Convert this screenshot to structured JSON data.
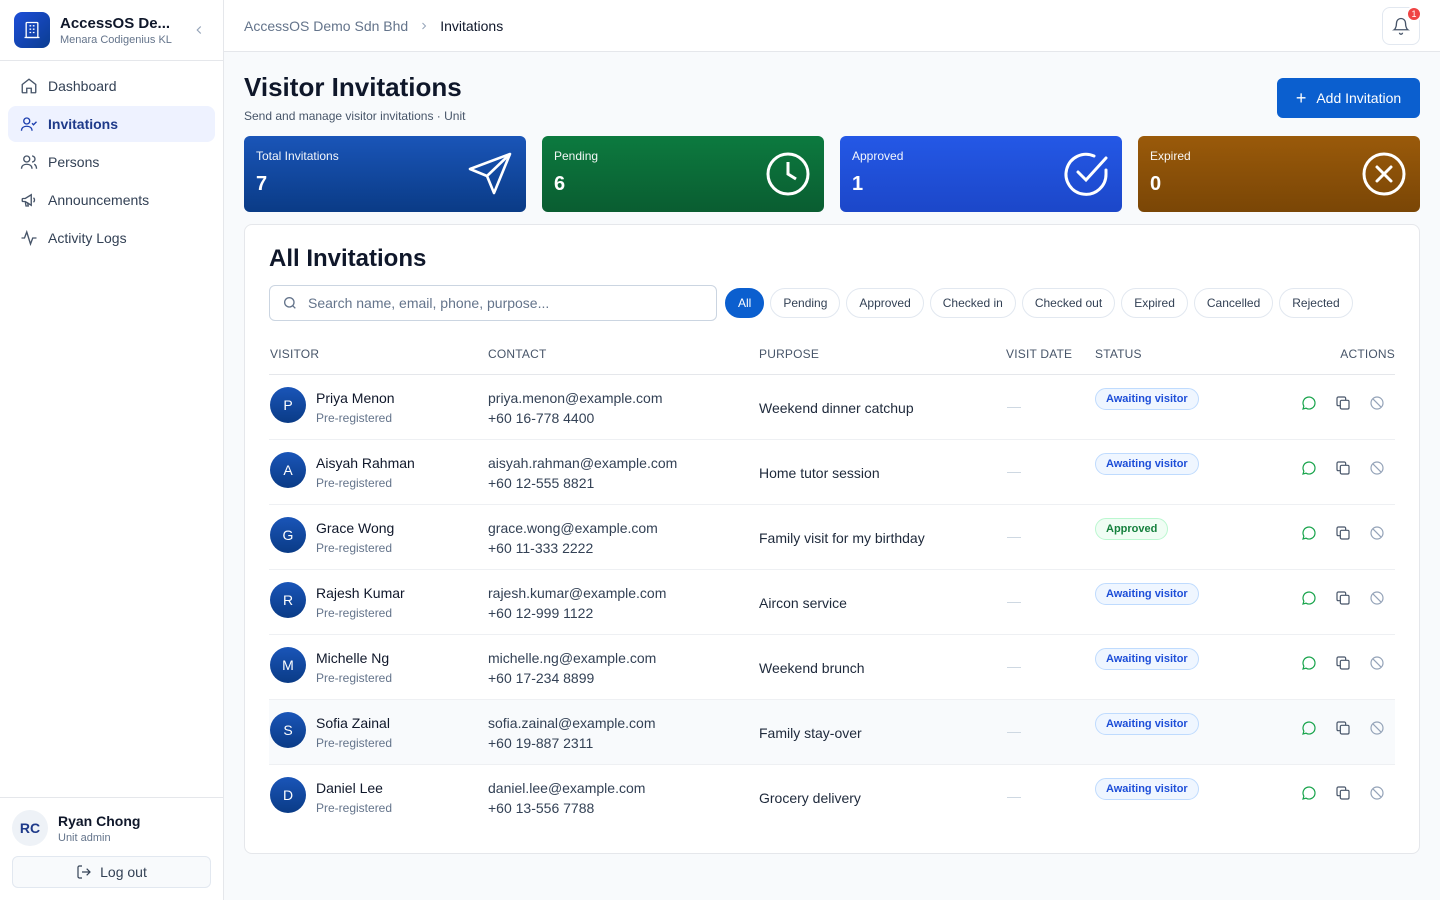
{
  "brand": {
    "name": "AccessOS De...",
    "site": "Menara Codigenius KL"
  },
  "nav": [
    {
      "label": "Dashboard",
      "icon": "home-icon"
    },
    {
      "label": "Invitations",
      "icon": "user-check-icon",
      "active": true
    },
    {
      "label": "Persons",
      "icon": "users-icon"
    },
    {
      "label": "Announcements",
      "icon": "megaphone-icon"
    },
    {
      "label": "Activity Logs",
      "icon": "activity-icon"
    }
  ],
  "user": {
    "initials": "RC",
    "name": "Ryan Chong",
    "role": "Unit admin",
    "logout_label": "Log out"
  },
  "breadcrumb": {
    "root": "AccessOS Demo Sdn Bhd",
    "current": "Invitations"
  },
  "notifications": {
    "count": "1"
  },
  "page": {
    "title": "Visitor Invitations",
    "subtitle": "Send and manage visitor invitations · Unit",
    "add_label": "Add Invitation"
  },
  "stats": [
    {
      "label": "Total Invitations",
      "value": "7",
      "icon": "send-icon",
      "color": "#0a3b86"
    },
    {
      "label": "Pending",
      "value": "6",
      "icon": "clock-icon",
      "color": "#0a5d31"
    },
    {
      "label": "Approved",
      "value": "1",
      "icon": "check-circle-icon",
      "color": "#1c47c9"
    },
    {
      "label": "Expired",
      "value": "0",
      "icon": "x-circle-icon",
      "color": "#7a4606"
    }
  ],
  "table": {
    "title": "All Invitations",
    "search_placeholder": "Search name, email, phone, purpose...",
    "filters": [
      "All",
      "Pending",
      "Approved",
      "Checked in",
      "Checked out",
      "Expired",
      "Cancelled",
      "Rejected"
    ],
    "active_filter": "All",
    "columns": {
      "visitor": "VISITOR",
      "contact": "CONTACT",
      "purpose": "PURPOSE",
      "visit_date": "VISIT DATE",
      "status": "STATUS",
      "actions": "ACTIONS"
    },
    "rows": [
      {
        "initial": "P",
        "name": "Priya Menon",
        "type": "Pre-registered",
        "email": "priya.menon@example.com",
        "phone": "+60 16-778 4400",
        "purpose": "Weekend dinner catchup",
        "visit_date": "—",
        "status": "Awaiting visitor",
        "status_kind": "await"
      },
      {
        "initial": "A",
        "name": "Aisyah Rahman",
        "type": "Pre-registered",
        "email": "aisyah.rahman@example.com",
        "phone": "+60 12-555 8821",
        "purpose": "Home tutor session",
        "visit_date": "—",
        "status": "Awaiting visitor",
        "status_kind": "await"
      },
      {
        "initial": "G",
        "name": "Grace Wong",
        "type": "Pre-registered",
        "email": "grace.wong@example.com",
        "phone": "+60 11-333 2222",
        "purpose": "Family visit for my birthday",
        "visit_date": "—",
        "status": "Approved",
        "status_kind": "appr"
      },
      {
        "initial": "R",
        "name": "Rajesh Kumar",
        "type": "Pre-registered",
        "email": "rajesh.kumar@example.com",
        "phone": "+60 12-999 1122",
        "purpose": "Aircon service",
        "visit_date": "—",
        "status": "Awaiting visitor",
        "status_kind": "await"
      },
      {
        "initial": "M",
        "name": "Michelle Ng",
        "type": "Pre-registered",
        "email": "michelle.ng@example.com",
        "phone": "+60 17-234 8899",
        "purpose": "Weekend brunch",
        "visit_date": "—",
        "status": "Awaiting visitor",
        "status_kind": "await"
      },
      {
        "initial": "S",
        "name": "Sofia Zainal",
        "type": "Pre-registered",
        "email": "sofia.zainal@example.com",
        "phone": "+60 19-887 2311",
        "purpose": "Family stay-over",
        "visit_date": "—",
        "status": "Awaiting visitor",
        "status_kind": "await",
        "highlight": true
      },
      {
        "initial": "D",
        "name": "Daniel Lee",
        "type": "Pre-registered",
        "email": "daniel.lee@example.com",
        "phone": "+60 13-556 7788",
        "purpose": "Grocery delivery",
        "visit_date": "—",
        "status": "Awaiting visitor",
        "status_kind": "await"
      }
    ]
  }
}
